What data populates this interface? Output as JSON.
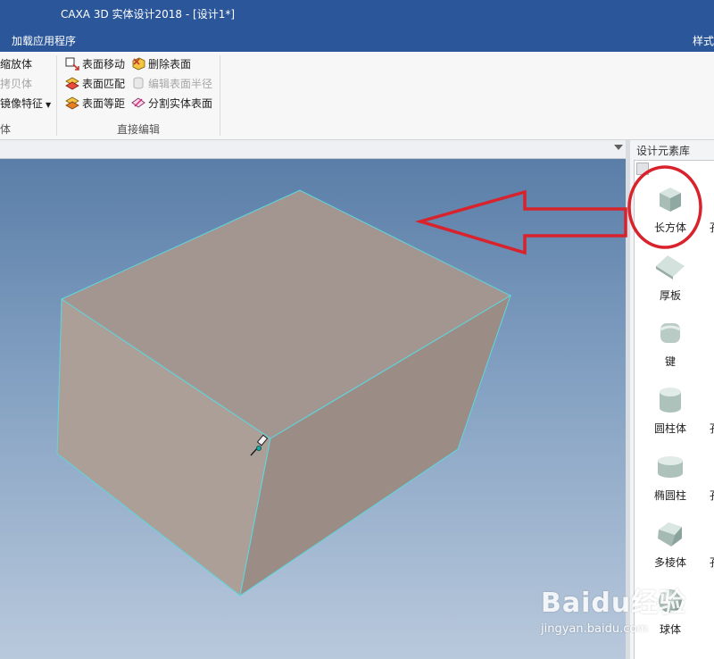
{
  "window": {
    "title": "CAXA 3D 实体设计2018 - [设计1*]"
  },
  "menu": {
    "tabs": [
      {
        "label": "加载应用程序"
      },
      {
        "label": "样式"
      }
    ]
  },
  "ribbon": {
    "col1": [
      {
        "label": "缩放体",
        "enabled": true
      },
      {
        "label": "拷贝体",
        "enabled": false
      },
      {
        "label": "镜像特征",
        "enabled": true
      }
    ],
    "col1_group_label": "体",
    "col2": [
      {
        "label": "表面移动",
        "enabled": true
      },
      {
        "label": "表面匹配",
        "enabled": true
      },
      {
        "label": "表面等距",
        "enabled": true
      }
    ],
    "col3": [
      {
        "label": "删除表面",
        "enabled": true
      },
      {
        "label": "编辑表面半径",
        "enabled": false
      },
      {
        "label": "分割实体表面",
        "enabled": true
      }
    ],
    "group_label": "直接编辑"
  },
  "design_library": {
    "title": "设计元素库",
    "items": [
      {
        "label": "长方体",
        "side": "孔",
        "icon": "cuboid-icon"
      },
      {
        "label": "厚板",
        "side": "",
        "icon": "thick-plate-icon"
      },
      {
        "label": "键",
        "side": "",
        "icon": "key-icon"
      },
      {
        "label": "圆柱体",
        "side": "孔",
        "icon": "cylinder-icon"
      },
      {
        "label": "椭圆柱",
        "side": "孔",
        "icon": "elliptic-cylinder-icon"
      },
      {
        "label": "多棱体",
        "side": "孔",
        "icon": "polyhedron-icon"
      },
      {
        "label": "球体",
        "side": "",
        "icon": "sphere-icon"
      }
    ]
  },
  "watermark": {
    "brand": "Baidu经验",
    "url": "jingyan.baidu.com"
  },
  "colors": {
    "titlebar": "#2b579a",
    "solid_face": "#a59891",
    "solid_edge": "#58d8e0",
    "annotation": "#d8222c"
  }
}
